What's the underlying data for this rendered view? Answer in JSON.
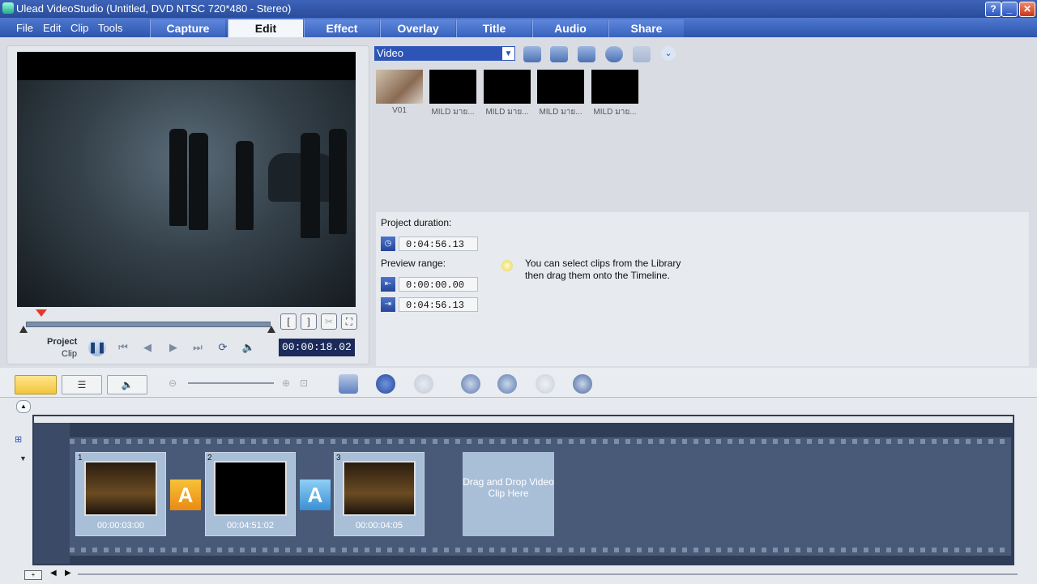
{
  "window": {
    "title": "Ulead VideoStudio (Untitled, DVD NTSC 720*480 - Stereo)",
    "help_btn": "?",
    "min_btn": "_",
    "max_btn": "□",
    "close_btn": "✕"
  },
  "menu": [
    "File",
    "Edit",
    "Clip",
    "Tools"
  ],
  "tabs": [
    "Capture",
    "Edit",
    "Effect",
    "Overlay",
    "Title",
    "Audio",
    "Share"
  ],
  "active_tab": "Edit",
  "preview": {
    "mode_project": "Project",
    "mode_clip": "Clip",
    "timecode": "00:00:18.02",
    "mark_in": "[",
    "mark_out": "]"
  },
  "library": {
    "category": "Video",
    "thumbnails": [
      {
        "caption": "V01"
      },
      {
        "caption": "MILD มาย..."
      },
      {
        "caption": "MILD มาย..."
      },
      {
        "caption": "MILD มาย..."
      },
      {
        "caption": "MILD มาย..."
      }
    ]
  },
  "options": {
    "project_duration_label": "Project duration:",
    "project_duration": "0:04:56.13",
    "preview_range_label": "Preview range:",
    "range_start": "0:00:00.00",
    "range_end": "0:04:56.13",
    "tip_line1": "You can select clips from the Library",
    "tip_line2": "then drag them onto the Timeline."
  },
  "timeline": {
    "clips": [
      {
        "number": "1",
        "duration": "00:00:03:00"
      },
      {
        "number": "2",
        "duration": "00:04:51:02"
      },
      {
        "number": "3",
        "duration": "00:00:04:05"
      }
    ],
    "transition_label": "A",
    "drop_zone": "Drag and Drop Video Clip Here"
  },
  "colors": {
    "accent": "#2d54b6",
    "timeline_bg": "#2f3d57",
    "clip_bg": "#a9bfd8"
  }
}
